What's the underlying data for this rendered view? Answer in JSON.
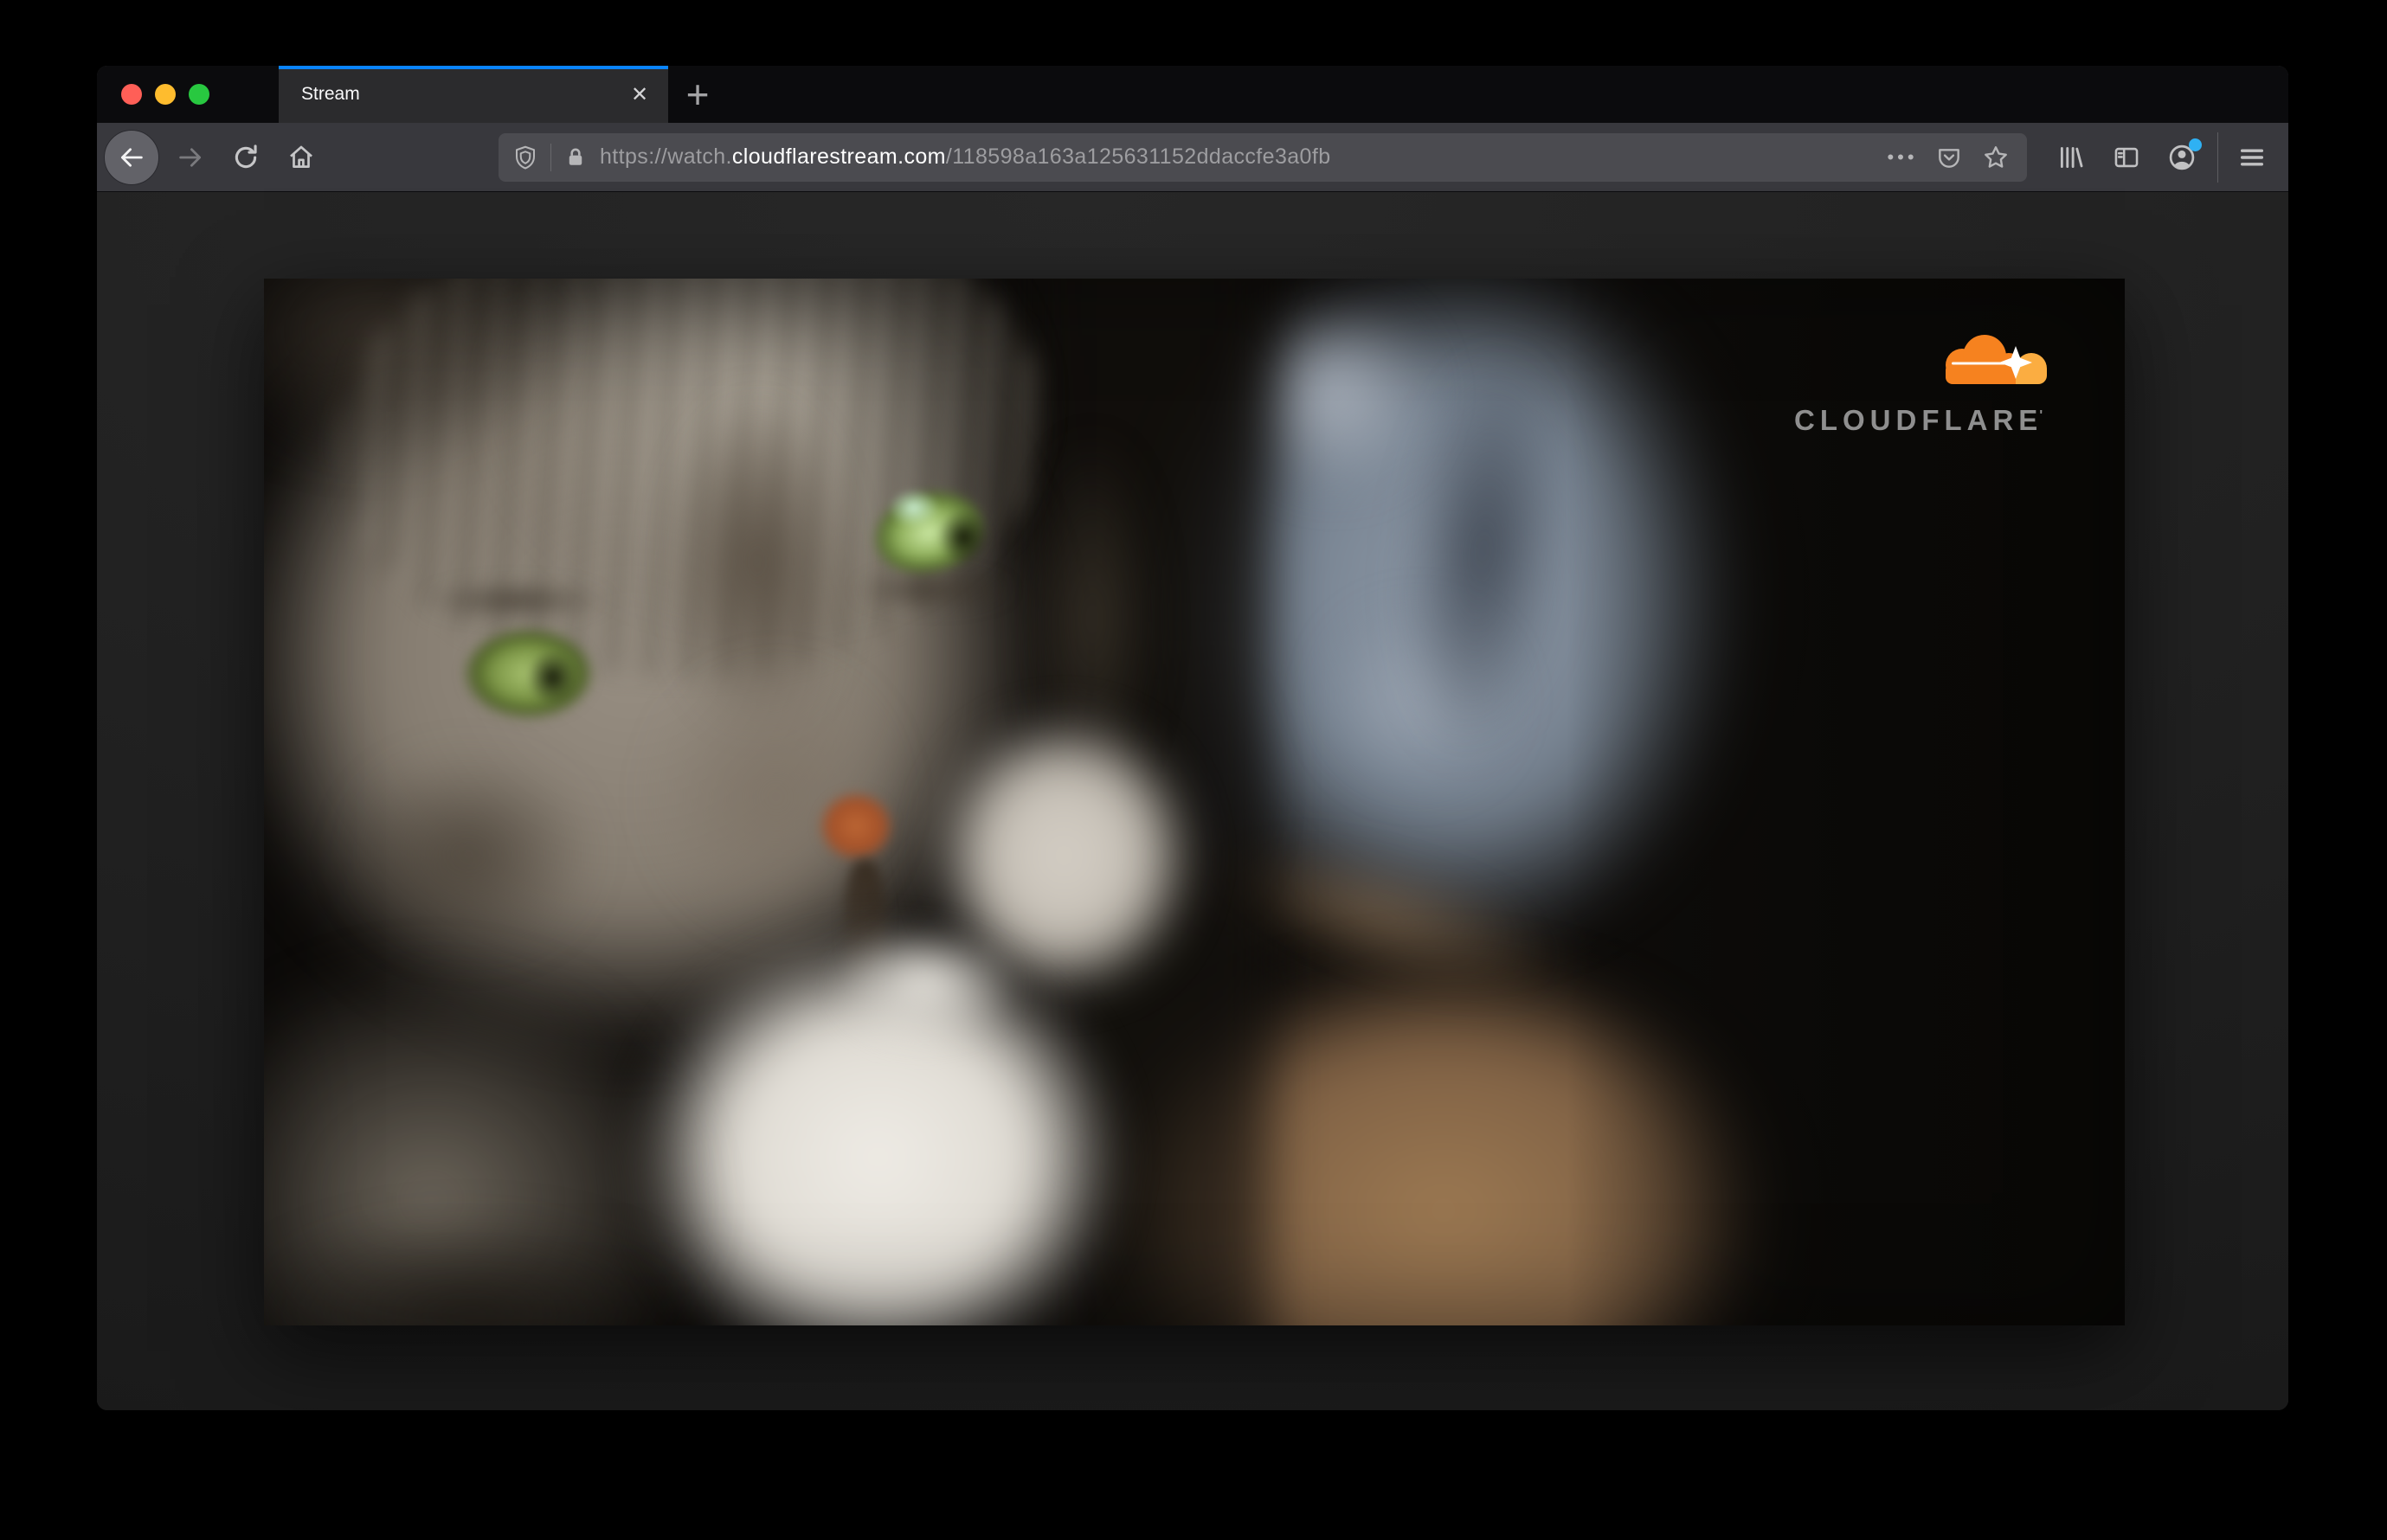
{
  "window": {
    "traffic_lights": [
      {
        "name": "close",
        "color": "#ff5f57"
      },
      {
        "name": "minimize",
        "color": "#febc2e"
      },
      {
        "name": "zoom",
        "color": "#28c840"
      }
    ]
  },
  "tabbar": {
    "tab": {
      "title": "Stream",
      "close_glyph": "✕",
      "accent_color": "#0a84ff"
    },
    "new_tab_glyph": "+"
  },
  "toolbar": {
    "url_bar": {
      "scheme_subdomain": "https://watch.",
      "domain": "cloudflarestream.com",
      "path": "/118598a163a125631152ddaccfe3a0fb",
      "page_actions_glyph": "•••"
    },
    "icons": [
      "back-arrow",
      "forward-arrow",
      "refresh",
      "home",
      "tracking-shield",
      "lock",
      "page-actions",
      "pocket",
      "bookmark-star",
      "library",
      "sidebar",
      "account",
      "menu"
    ],
    "account_notification_dot_color": "#2fb1f3"
  },
  "video": {
    "alt_description": "Blurred close-up frame of a gray tabby cat with green eyes against a blue-gray and dark background",
    "brand": {
      "wordmark": "CLOUDFLARE",
      "trademark_glyph": "'",
      "cloud_orange": "#f6821f",
      "cloud_light_orange": "#fbad41",
      "wordmark_color": "#8f8f8f"
    }
  }
}
